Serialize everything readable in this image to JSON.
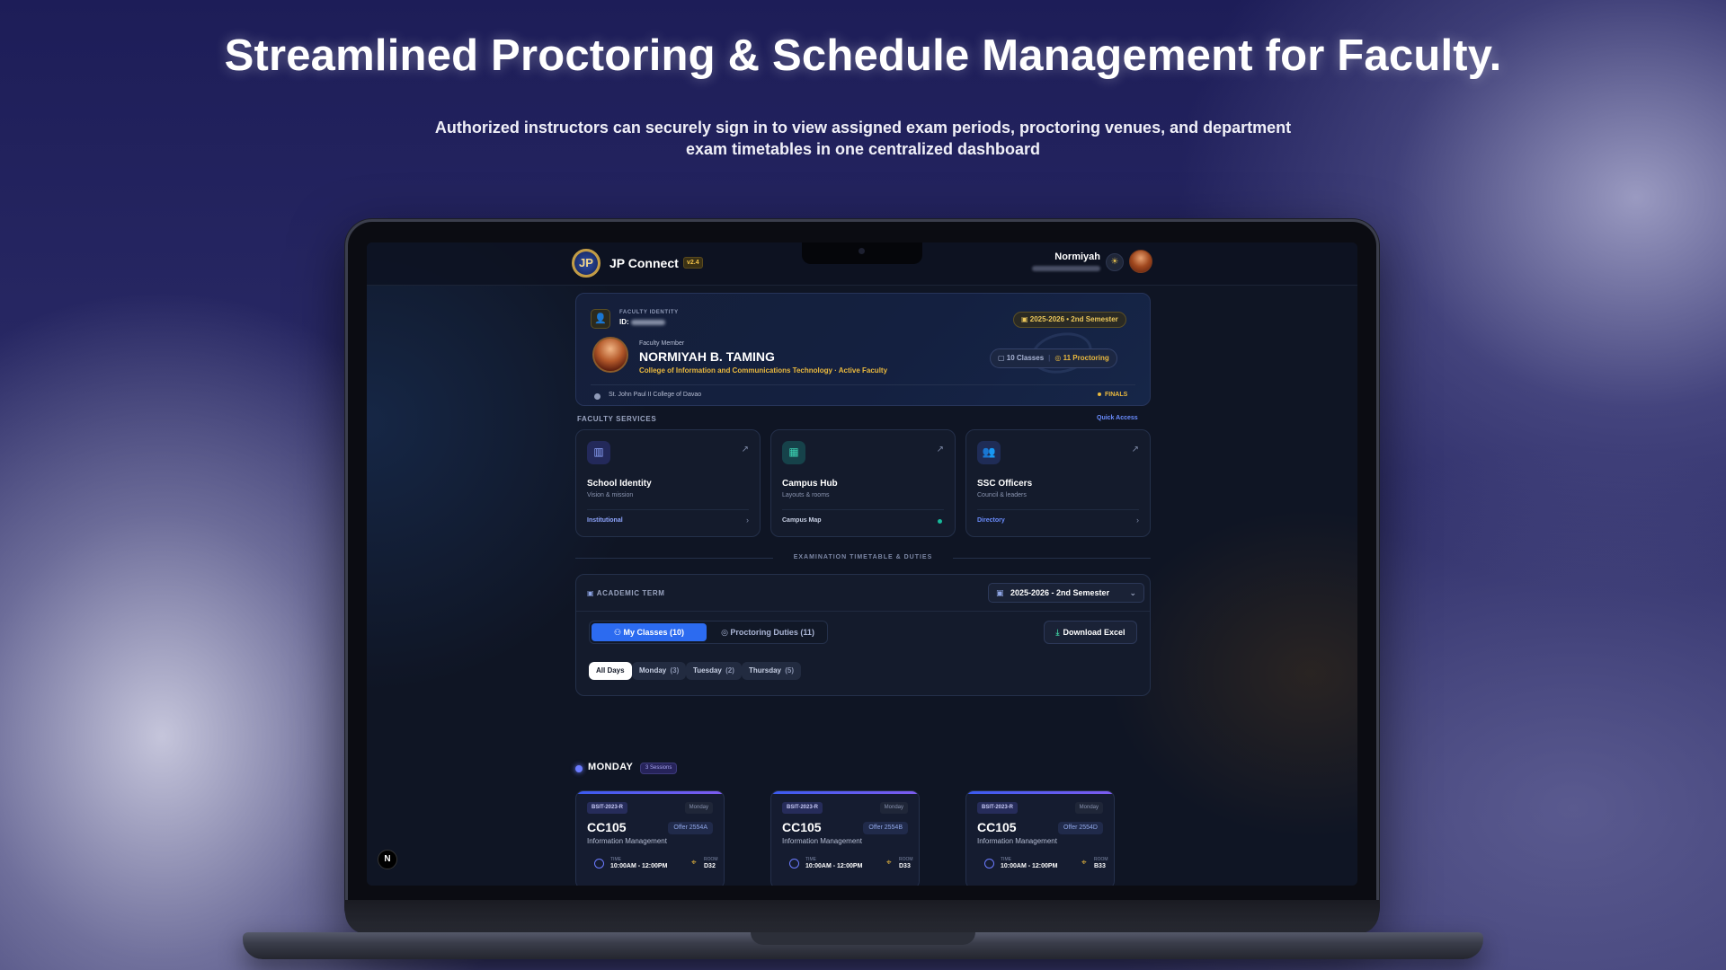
{
  "hero": {
    "title": "Streamlined Proctoring & Schedule Management for Faculty.",
    "subtitle": "Authorized instructors can securely sign in to view assigned exam periods, proctoring venues, and department exam timetables in one centralized dashboard"
  },
  "header": {
    "app_name": "JP Connect",
    "version": "v2.4",
    "user_name": "Normiyah",
    "theme_icon": "sun-icon"
  },
  "identity": {
    "label": "FACULTY IDENTITY",
    "id_prefix": "ID:",
    "term": "2025-2026 • 2nd Semester",
    "role": "Faculty Member",
    "name": "NORMIYAH B. TAMING",
    "department": "College of Information and Communications Technology · Active Faculty",
    "classes": "10 Classes",
    "proctoring": "11 Proctoring",
    "school": "St. John Paul II College of Davao",
    "period": "FINALS"
  },
  "services": {
    "label": "FACULTY SERVICES",
    "quick_access": "Quick Access",
    "items": [
      {
        "title": "School Identity",
        "sub": "Vision & mission",
        "link": "Institutional",
        "icon": "book-icon",
        "color": "#8fa6ff"
      },
      {
        "title": "Campus Hub",
        "sub": "Layouts & rooms",
        "link": "Campus Map",
        "icon": "building-icon",
        "color": "#c8d0e4"
      },
      {
        "title": "SSC Officers",
        "sub": "Council & leaders",
        "link": "Directory",
        "icon": "users-icon",
        "color": "#6b8dff"
      }
    ]
  },
  "exam": {
    "divider": "EXAMINATION TIMETABLE & DUTIES",
    "term_label": "ACADEMIC TERM",
    "term_select": "2025-2026 - 2nd Semester",
    "tab_classes": "My Classes (10)",
    "tab_proctoring": "Proctoring Duties (11)",
    "download": "Download Excel",
    "days": [
      {
        "label": "All Days",
        "count": ""
      },
      {
        "label": "Monday",
        "count": "(3)"
      },
      {
        "label": "Tuesday",
        "count": "(2)"
      },
      {
        "label": "Thursday",
        "count": "(5)"
      }
    ]
  },
  "monday": {
    "title": "MONDAY",
    "badge": "3 Sessions",
    "time_label": "TIME",
    "room_label": "ROOM",
    "cards": [
      {
        "section": "BSIT-2023-R",
        "day": "Monday",
        "code": "CC105",
        "offer": "Offer 2554A",
        "name": "Information Management",
        "time": "10:00AM - 12:00PM",
        "room": "D32"
      },
      {
        "section": "BSIT-2023-R",
        "day": "Monday",
        "code": "CC105",
        "offer": "Offer 2554B",
        "name": "Information Management",
        "time": "10:00AM - 12:00PM",
        "room": "D33"
      },
      {
        "section": "BSIT-2023-R",
        "day": "Monday",
        "code": "CC105",
        "offer": "Offer 2554D",
        "name": "Information Management",
        "time": "10:00AM - 12:00PM",
        "room": "B33"
      }
    ]
  },
  "colors": {
    "accent": "#2c6bf0",
    "gold": "#eab93e",
    "teal": "#18b89a",
    "background": "#0f1524"
  }
}
